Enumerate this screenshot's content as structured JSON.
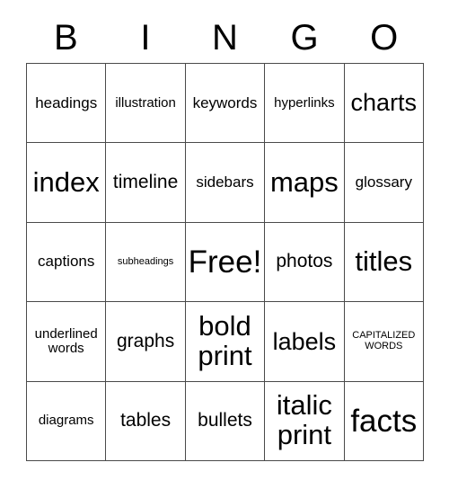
{
  "card": {
    "title": "BINGO",
    "header_letters": [
      "B",
      "I",
      "N",
      "G",
      "O"
    ],
    "free_space_label": "Free!",
    "rows": [
      [
        {
          "label": "headings",
          "size": "m"
        },
        {
          "label": "illustration",
          "size": "s"
        },
        {
          "label": "keywords",
          "size": "m"
        },
        {
          "label": "hyperlinks",
          "size": "s"
        },
        {
          "label": "charts",
          "size": "xl"
        }
      ],
      [
        {
          "label": "index",
          "size": "xxl"
        },
        {
          "label": "timeline",
          "size": "l"
        },
        {
          "label": "sidebars",
          "size": "m"
        },
        {
          "label": "maps",
          "size": "xxl"
        },
        {
          "label": "glossary",
          "size": "m"
        }
      ],
      [
        {
          "label": "captions",
          "size": "m"
        },
        {
          "label": "subheadings",
          "size": "xs"
        },
        {
          "label": "Free!",
          "size": "huge"
        },
        {
          "label": "photos",
          "size": "l"
        },
        {
          "label": "titles",
          "size": "xxl"
        }
      ],
      [
        {
          "label": "underlined\nwords",
          "size": "s"
        },
        {
          "label": "graphs",
          "size": "l"
        },
        {
          "label": "bold\nprint",
          "size": "xxl"
        },
        {
          "label": "labels",
          "size": "xl"
        },
        {
          "label": "CAPITALIZED\nWORDS",
          "size": "xs"
        }
      ],
      [
        {
          "label": "diagrams",
          "size": "s"
        },
        {
          "label": "tables",
          "size": "l"
        },
        {
          "label": "bullets",
          "size": "l"
        },
        {
          "label": "italic\nprint",
          "size": "xxl"
        },
        {
          "label": "facts",
          "size": "huge"
        }
      ]
    ]
  },
  "colors": {
    "background": "#ffffff",
    "text": "#000000",
    "grid_line": "#4a4a4a"
  }
}
